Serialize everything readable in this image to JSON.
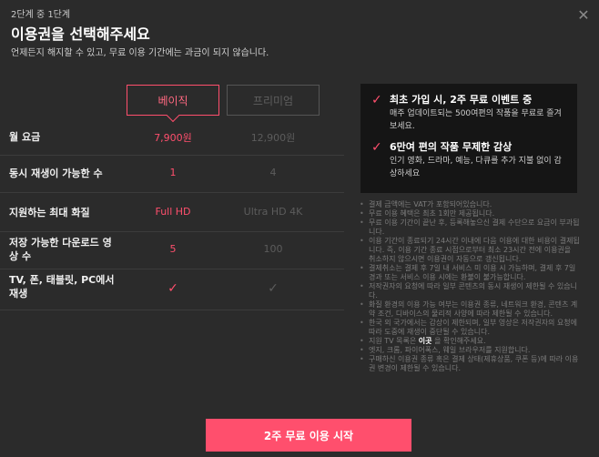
{
  "header": {
    "step": "2단계 중 1단계",
    "title": "이용권을 선택해주세요",
    "subtitle": "언제든지 해지할 수 있고, 무료 이용 기간에는 과금이 되지 않습니다.",
    "close_icon": "close-icon"
  },
  "plans": {
    "basic": "베이직",
    "premium": "프리미엄"
  },
  "rows": [
    {
      "label": "월 요금",
      "basic": "7,900원",
      "premium": "12,900원"
    },
    {
      "label": "동시 재생이 가능한 수",
      "basic": "1",
      "premium": "4"
    },
    {
      "label": "지원하는 최대 화질",
      "basic": "Full HD",
      "premium": "Ultra HD 4K"
    },
    {
      "label": "저장 가능한 다운로드 영상 수",
      "basic": "5",
      "premium": "100"
    },
    {
      "label": "TV, 폰, 태블릿, PC에서 재생",
      "basic": "check-icon",
      "premium": "check-icon"
    }
  ],
  "promo": [
    {
      "title": "최초 가입 시, 2주 무료 이벤트 중",
      "desc": "매주 업데이트되는 500여편의 작품을 무료로 즐겨보세요."
    },
    {
      "title": "6만여 편의 작품 무제한 감상",
      "desc": "인기 영화, 드라마, 예능, 다큐를 추가 지불 없이 감상하세요"
    }
  ],
  "notes": [
    "결제 금액에는 VAT가 포함되어있습니다.",
    "무료 이용 혜택은 최초 1회만 제공됩니다.",
    "무료 이용 기간이 끝난 후, 등록해놓으신 결제 수단으로 요금이 부과됩니다.",
    "이용 기간이 종료되기 24시간 이내에 다음 이용에 대한 비용이 결제됩니다. 즉, 이용 기간 종료 시점으로부터 최소 23시간 전에 이용권을 취소하지 않으시면 이용권이 자동으로 갱신됩니다.",
    "결제취소는 결제 후 7일 내 서비스 미 이용 시 가능하며, 결제 후 7일 경과 또는 서비스 이용 시에는 환불이 불가능합니다.",
    "저작권자의 요청에 따라 일부 콘텐츠의 동시 재생이 제한될 수 있습니다.",
    "화질 환경의 이용 가능 여부는 이용권 종류, 네트워크 환경, 콘텐츠 계약 조건, 디바이스의 물리적 사양에 따라 제한될 수 있습니다.",
    "한국 외 국가에서는 감상이 제한되며, 일부 영상은 저작권자의 요청에 따라 도중에 재생이 중단될 수 있습니다.",
    "지원 TV 목록은 |이곳| 을 확인해주세요.",
    "엣지, 크롬, 파이어폭스, 웨일 브라우저를 지원합니다.",
    "구매하신 이용권 종류 혹은 결제 상태(제휴상품, 쿠폰 등)에 따라 이용권 변경이 제한될 수 있습니다."
  ],
  "notes_link": {
    "prefix": "지원 TV 목록은 ",
    "link": "이곳",
    "suffix": " 을 확인해주세요."
  },
  "cta": "2주 무료 이용 시작",
  "colors": {
    "accent": "#ff4f6d",
    "background": "#2b2b2b",
    "panel": "#151515"
  }
}
